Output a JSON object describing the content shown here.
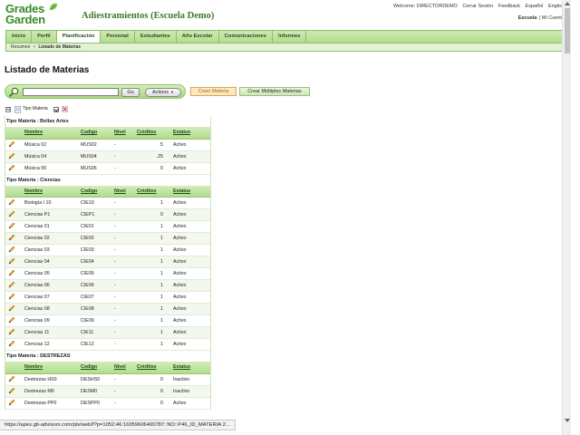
{
  "brand": {
    "logo_line1": "Grades",
    "logo_line2": "Garden",
    "app_title": "Adiestramientos (Escuela Demo)"
  },
  "top_links": {
    "welcome": "Welcome: DIRECTORDEMO",
    "logout": "Cerrar Sesión",
    "feedback": "Feedback",
    "spanish": "Español",
    "english": "English"
  },
  "scope": {
    "school": "Escuela",
    "separator": "|",
    "account": "Mi Cuenta"
  },
  "nav": [
    {
      "label": "Inicio",
      "active": false
    },
    {
      "label": "Perfil",
      "active": false
    },
    {
      "label": "Planificación",
      "active": true
    },
    {
      "label": "Personal",
      "active": false
    },
    {
      "label": "Estudiantes",
      "active": false
    },
    {
      "label": "Año Escolar",
      "active": false
    },
    {
      "label": "Comunicaciones",
      "active": false
    },
    {
      "label": "Informes",
      "active": false
    }
  ],
  "breadcrumb": {
    "first": "Resumen",
    "separator": ">",
    "current": "Listado de Materias"
  },
  "page_title": "Listado de Materias",
  "search": {
    "value": "",
    "go_label": "Go",
    "actions_label": "Actions",
    "actions_caret": "▼"
  },
  "buttons": {
    "create_one": "Crear Materia",
    "create_multi": "Crear Múltiples Materias"
  },
  "control_break": {
    "collapse": "⊟",
    "label": "Tipo Materia"
  },
  "columns": {
    "nombre": "Nombre",
    "codigo": "Codigo",
    "nivel": "Nivel",
    "creditos": "Créditos",
    "estatus": "Estatus"
  },
  "groups": [
    {
      "title": "Tipo Materia : Bellas Artes",
      "rows": [
        {
          "nombre": "Música 02",
          "codigo": "MUS02",
          "nivel": "-",
          "creditos": ".5",
          "estatus": "Activo"
        },
        {
          "nombre": "Música 04",
          "codigo": "MUS04",
          "nivel": "-",
          "creditos": ".25",
          "estatus": "Activo"
        },
        {
          "nombre": "Música 06",
          "codigo": "MUS06",
          "nivel": "-",
          "creditos": "0",
          "estatus": "Activo"
        }
      ]
    },
    {
      "title": "Tipo Materia : Ciencias",
      "rows": [
        {
          "nombre": "Biología I 10",
          "codigo": "CIE10",
          "nivel": "-",
          "creditos": "1",
          "estatus": "Activo"
        },
        {
          "nombre": "Ciencias P1",
          "codigo": "CIEP1",
          "nivel": "-",
          "creditos": "0",
          "estatus": "Activo"
        },
        {
          "nombre": "Ciencias 01",
          "codigo": "CIE01",
          "nivel": "-",
          "creditos": "1",
          "estatus": "Activo"
        },
        {
          "nombre": "Ciencias 02",
          "codigo": "CIE02",
          "nivel": "-",
          "creditos": "1",
          "estatus": "Activo"
        },
        {
          "nombre": "Ciencias 03",
          "codigo": "CIE03",
          "nivel": "-",
          "creditos": "1",
          "estatus": "Activo"
        },
        {
          "nombre": "Ciencias 04",
          "codigo": "CIE04",
          "nivel": "-",
          "creditos": "1",
          "estatus": "Activo"
        },
        {
          "nombre": "Ciencias 05",
          "codigo": "CIE05",
          "nivel": "-",
          "creditos": "1",
          "estatus": "Activo"
        },
        {
          "nombre": "Ciencias 06",
          "codigo": "CIE06",
          "nivel": "-",
          "creditos": "1",
          "estatus": "Activo"
        },
        {
          "nombre": "Ciencias 07",
          "codigo": "CIE07",
          "nivel": "-",
          "creditos": "1",
          "estatus": "Activo"
        },
        {
          "nombre": "Ciencias 08",
          "codigo": "CIE08",
          "nivel": "-",
          "creditos": "1",
          "estatus": "Activo"
        },
        {
          "nombre": "Ciencias 09",
          "codigo": "CIE09",
          "nivel": "-",
          "creditos": "1",
          "estatus": "Activo"
        },
        {
          "nombre": "Ciencias 11",
          "codigo": "CIE11",
          "nivel": "-",
          "creditos": "1",
          "estatus": "Activo"
        },
        {
          "nombre": "Ciencias 12",
          "codigo": "CIE12",
          "nivel": "-",
          "creditos": "1",
          "estatus": "Activo"
        }
      ]
    },
    {
      "title": "Tipo Materia : DESTREZAS",
      "rows": [
        {
          "nombre": "Destrezas HS0",
          "codigo": "DESHS0",
          "nivel": "-",
          "creditos": "0",
          "estatus": "Inactivo"
        },
        {
          "nombre": "Destrezas M0",
          "codigo": "DESM0",
          "nivel": "-",
          "creditos": "0",
          "estatus": "Inactivo"
        },
        {
          "nombre": "Destrezas PP0",
          "codigo": "DESPP0",
          "nivel": "-",
          "creditos": "0",
          "estatus": "Activo"
        }
      ]
    }
  ],
  "status_url": "https://apex.gb-advisors.com/pls/web/f?p=1052:46:16959606400787::NO::P46_ID_MATERIA:2...",
  "colors": {
    "brand_green": "#3a8a25",
    "nav_green": "#b3dd8f",
    "create_orange": "#a26a13"
  }
}
